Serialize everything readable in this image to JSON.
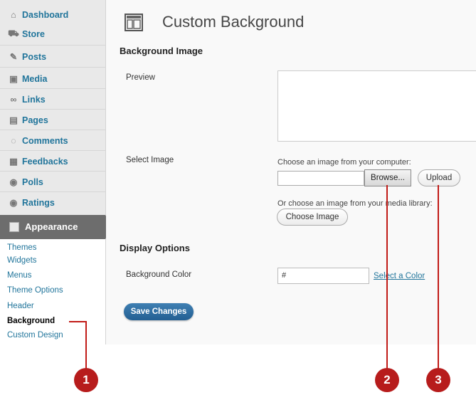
{
  "sidebar": {
    "items": [
      {
        "label": "Dashboard",
        "icon": "house-icon"
      },
      {
        "label": "Store",
        "icon": "cart-icon"
      },
      {
        "label": "Posts",
        "icon": "pushpin-icon"
      },
      {
        "label": "Media",
        "icon": "media-icon"
      },
      {
        "label": "Links",
        "icon": "link-icon"
      },
      {
        "label": "Pages",
        "icon": "pages-icon"
      },
      {
        "label": "Comments",
        "icon": "speech-bubble-icon"
      },
      {
        "label": "Feedbacks",
        "icon": "feedback-form-icon"
      },
      {
        "label": "Polls",
        "icon": "poll-icon"
      },
      {
        "label": "Ratings",
        "icon": "ratings-icon"
      }
    ],
    "appearance": {
      "label": "Appearance",
      "icon": "appearance-icon"
    },
    "submenu": [
      "Themes",
      "Widgets",
      "Menus",
      "Theme Options",
      "Header",
      "Background",
      "Custom Design"
    ]
  },
  "page": {
    "title": "Custom Background",
    "background_image_heading": "Background Image",
    "preview_label": "Preview",
    "select_image_label": "Select Image",
    "choose_computer_text": "Choose an image from your computer:",
    "browse_label": "Browse...",
    "upload_label": "Upload",
    "choose_library_text": "Or choose an image from your media library:",
    "choose_image_label": "Choose Image",
    "display_options_heading": "Display Options",
    "background_color_label": "Background Color",
    "color_value": "#",
    "select_color_label": "Select a Color",
    "save_label": "Save Changes"
  },
  "callouts": [
    "1",
    "2",
    "3"
  ],
  "colors": {
    "link": "#21759b",
    "callout": "#b71c1c",
    "save_button": "#2e6da4"
  }
}
